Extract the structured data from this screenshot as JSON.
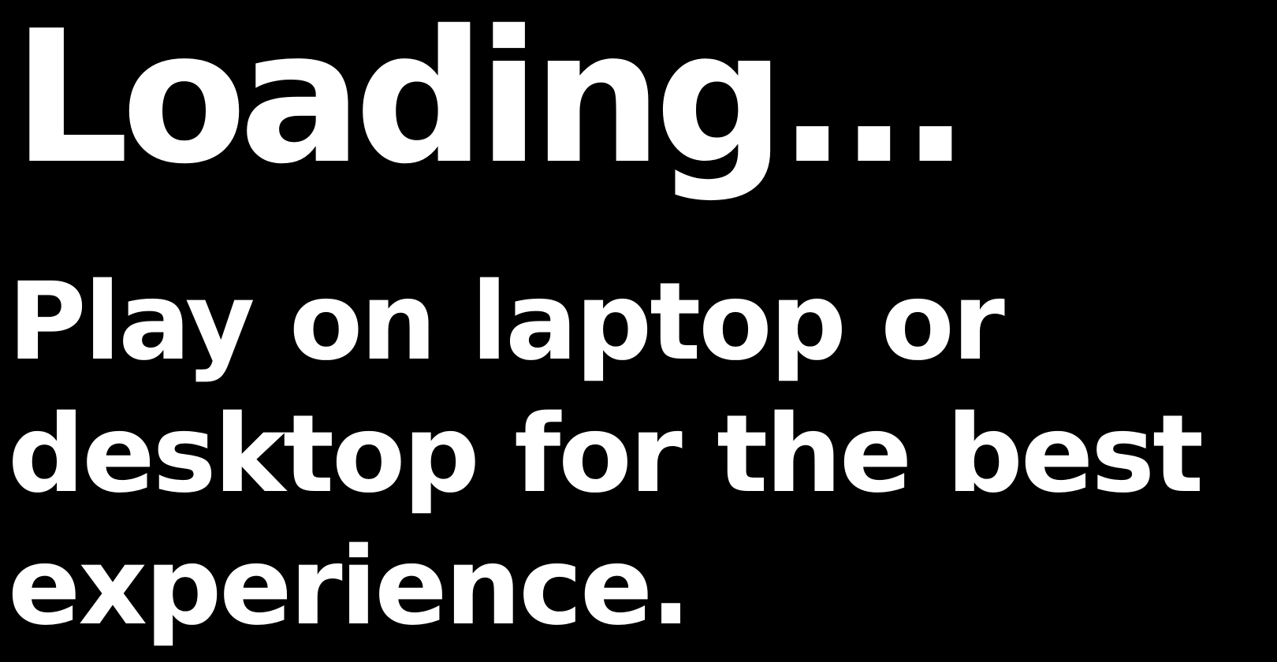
{
  "screen": {
    "title": "Loading...",
    "message_lines": [
      "Play on laptop or",
      "desktop for the best",
      "experience."
    ]
  },
  "colors": {
    "background": "#000000",
    "text": "#ffffff"
  }
}
